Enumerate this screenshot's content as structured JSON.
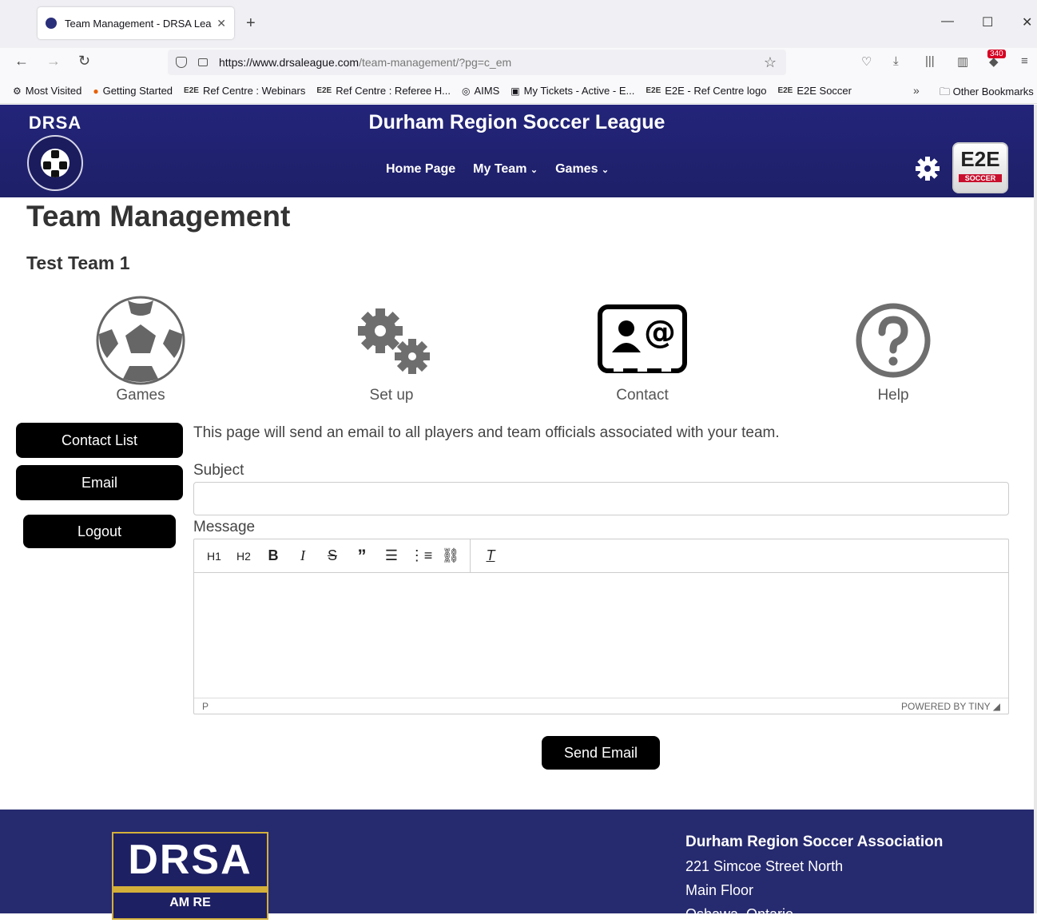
{
  "browser": {
    "tab_title": "Team Management - DRSA Lea",
    "url_host": "https://www.drsaleague.com",
    "url_path": "/team-management/?pg=c_em",
    "notification_count": "340",
    "bookmarks": [
      "Most Visited",
      "Getting Started",
      "Ref Centre : Webinars",
      "Ref Centre : Referee H...",
      "AIMS",
      "My Tickets - Active - E...",
      "E2E - Ref Centre logo",
      "E2E Soccer"
    ],
    "other_bookmarks": "Other Bookmarks"
  },
  "header": {
    "logo_text": "DRSA",
    "site_title": "Durham Region Soccer League",
    "nav": [
      "Home Page",
      "My Team",
      "Games"
    ],
    "e2e_logo": "E2E",
    "e2e_sub": "SOCCER"
  },
  "page": {
    "title": "Team Management",
    "team_name": "Test Team 1",
    "features": [
      "Games",
      "Set up",
      "Contact",
      "Help"
    ],
    "sidebar": [
      "Contact List",
      "Email",
      "Logout"
    ],
    "intro": "This page will send an email to all players and team officials associated with your team.",
    "subject_label": "Subject",
    "subject_value": "",
    "message_label": "Message",
    "toolbar": {
      "h1": "H1",
      "h2": "H2"
    },
    "editor_path": "P",
    "powered_by": "POWERED BY TINY",
    "send_button": "Send Email"
  },
  "footer": {
    "logo_text": "DRSA",
    "logo_sub": "AM RE",
    "org": "Durham Region Soccer Association",
    "address1": "221 Simcoe Street North",
    "address2": "Main Floor",
    "address3": "Oshawa, Ontario"
  }
}
